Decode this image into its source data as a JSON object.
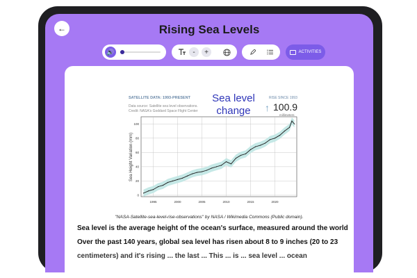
{
  "header": {
    "title": "Rising Sea Levels",
    "back_icon": "arrow-left-icon"
  },
  "toolbar": {
    "audio": {
      "volume_icon": "speaker-icon",
      "progress_fraction": 0.05
    },
    "text_controls": {
      "text_size_icon": "text-size-icon",
      "decrease_label": "-",
      "increase_label": "+",
      "language_icon": "globe-icon"
    },
    "tools": {
      "pen_icon": "pen-icon",
      "list_icon": "list-icon"
    },
    "activities_label": "ACTIVITIES",
    "activities_icon": "monitor-icon"
  },
  "article": {
    "chart_header": {
      "satellite_label": "SATELLITE DATA: 1993-PRESENT",
      "source_line1": "Data source: Satellite sea level observations.",
      "source_line2": "Credit: NASA's Goddard Space Flight Center",
      "title_line1": "Sea level",
      "title_line2": "change",
      "rise_label": "RISE SINCE 1993",
      "rise_value": "100.9",
      "rise_unit": "millimeters",
      "y_axis_label": "Sea Height Variation (mm)"
    },
    "chart_data": {
      "type": "line",
      "ylabel": "Sea Height Variation (mm)",
      "xlim": [
        1992.5,
        2024.5
      ],
      "ylim": [
        -2,
        110
      ],
      "x_ticks": [
        1995,
        2000,
        2005,
        2010,
        2015,
        2020
      ],
      "y_ticks": [
        0,
        20,
        40,
        60,
        80,
        100
      ],
      "grid": true,
      "series": [
        {
          "x": [
            1993,
            1994,
            1995,
            1996,
            1997,
            1998,
            1999,
            2000,
            2001,
            2002,
            2003,
            2004,
            2005,
            2006,
            2007,
            2008,
            2009,
            2010,
            2011,
            2012,
            2013,
            2014,
            2015,
            2016,
            2017,
            2018,
            2019,
            2020,
            2021,
            2022,
            2023,
            2023.5,
            2024
          ],
          "y": [
            3,
            6,
            8,
            12,
            14,
            18,
            20,
            22,
            24,
            27,
            30,
            32,
            33,
            35,
            38,
            40,
            42,
            47,
            44,
            52,
            56,
            58,
            64,
            68,
            70,
            73,
            78,
            80,
            84,
            90,
            95,
            104,
            100
          ]
        }
      ]
    },
    "caption": "\"NASA-Satellite-sea-level-rise-observations\" by NASA / Wikimedia Commons (Public domain).",
    "paragraph_line1": "Sea level is the average height of the ocean's surface, measured around the world.",
    "paragraph_line2": "Over the past 140 years, global sea level has risen about 8 to 9 inches (20 to 23",
    "paragraph_line3": "centimeters) and it's rising ... the last ... This ... is ... sea level ... ocean"
  }
}
